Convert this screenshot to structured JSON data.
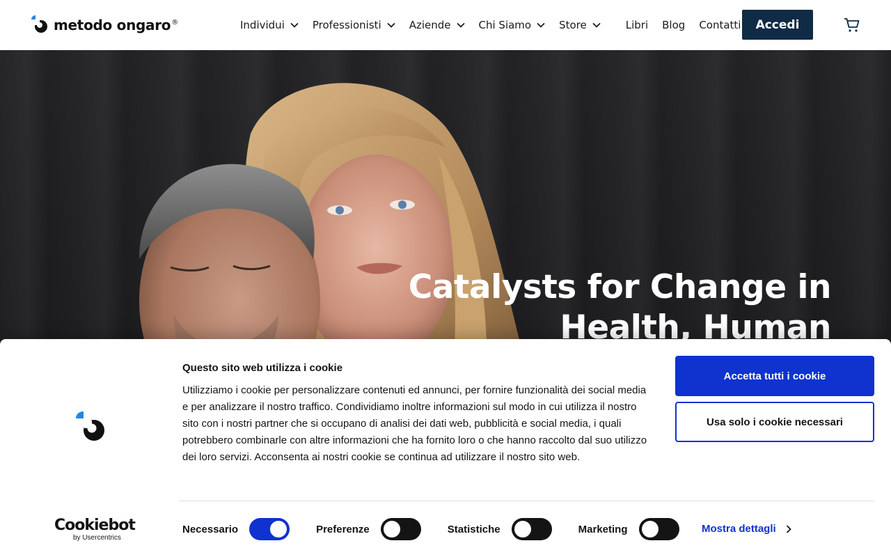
{
  "brand": {
    "name": "metodo ongaro",
    "registered": "®"
  },
  "nav": {
    "items": [
      {
        "label": "Individui",
        "dropdown": true
      },
      {
        "label": "Professionisti",
        "dropdown": true
      },
      {
        "label": "Aziende",
        "dropdown": true
      },
      {
        "label": "Chi Siamo",
        "dropdown": true
      },
      {
        "label": "Store",
        "dropdown": true
      },
      {
        "label": "Libri",
        "dropdown": false
      },
      {
        "label": "Blog",
        "dropdown": false
      },
      {
        "label": "Contatti",
        "dropdown": false
      }
    ],
    "login_label": "Accedi",
    "cart_icon": "cart-icon"
  },
  "hero": {
    "title": "Catalysts for Change in Health, Human"
  },
  "cookie_banner": {
    "title": "Questo sito web utilizza i cookie",
    "body": "Utilizziamo i cookie per personalizzare contenuti ed annunci, per fornire funzionalità dei social media e per analizzare il nostro traffico. Condividiamo inoltre informazioni sul modo in cui utilizza il nostro sito con i nostri partner che si occupano di analisi dei dati web, pubblicità e social media, i quali potrebbero combinarle con altre informazioni che ha fornito loro o che hanno raccolto dal suo utilizzo dei loro servizi. Acconsenta ai nostri cookie se continua ad utilizzare il nostro sito web.",
    "accept_all_label": "Accetta tutti i cookie",
    "necessary_only_label": "Usa solo i cookie necessari",
    "provider_name": "Cookiebot",
    "provider_sub": "by Usercentrics",
    "toggles": [
      {
        "label": "Necessario",
        "on": true
      },
      {
        "label": "Preferenze",
        "on": false
      },
      {
        "label": "Statistiche",
        "on": false
      },
      {
        "label": "Marketing",
        "on": false
      }
    ],
    "details_label": "Mostra dettagli"
  },
  "colors": {
    "primary_dark": "#0f2b45",
    "accent_blue": "#1032cf",
    "logo_blue": "#1e88e5"
  }
}
